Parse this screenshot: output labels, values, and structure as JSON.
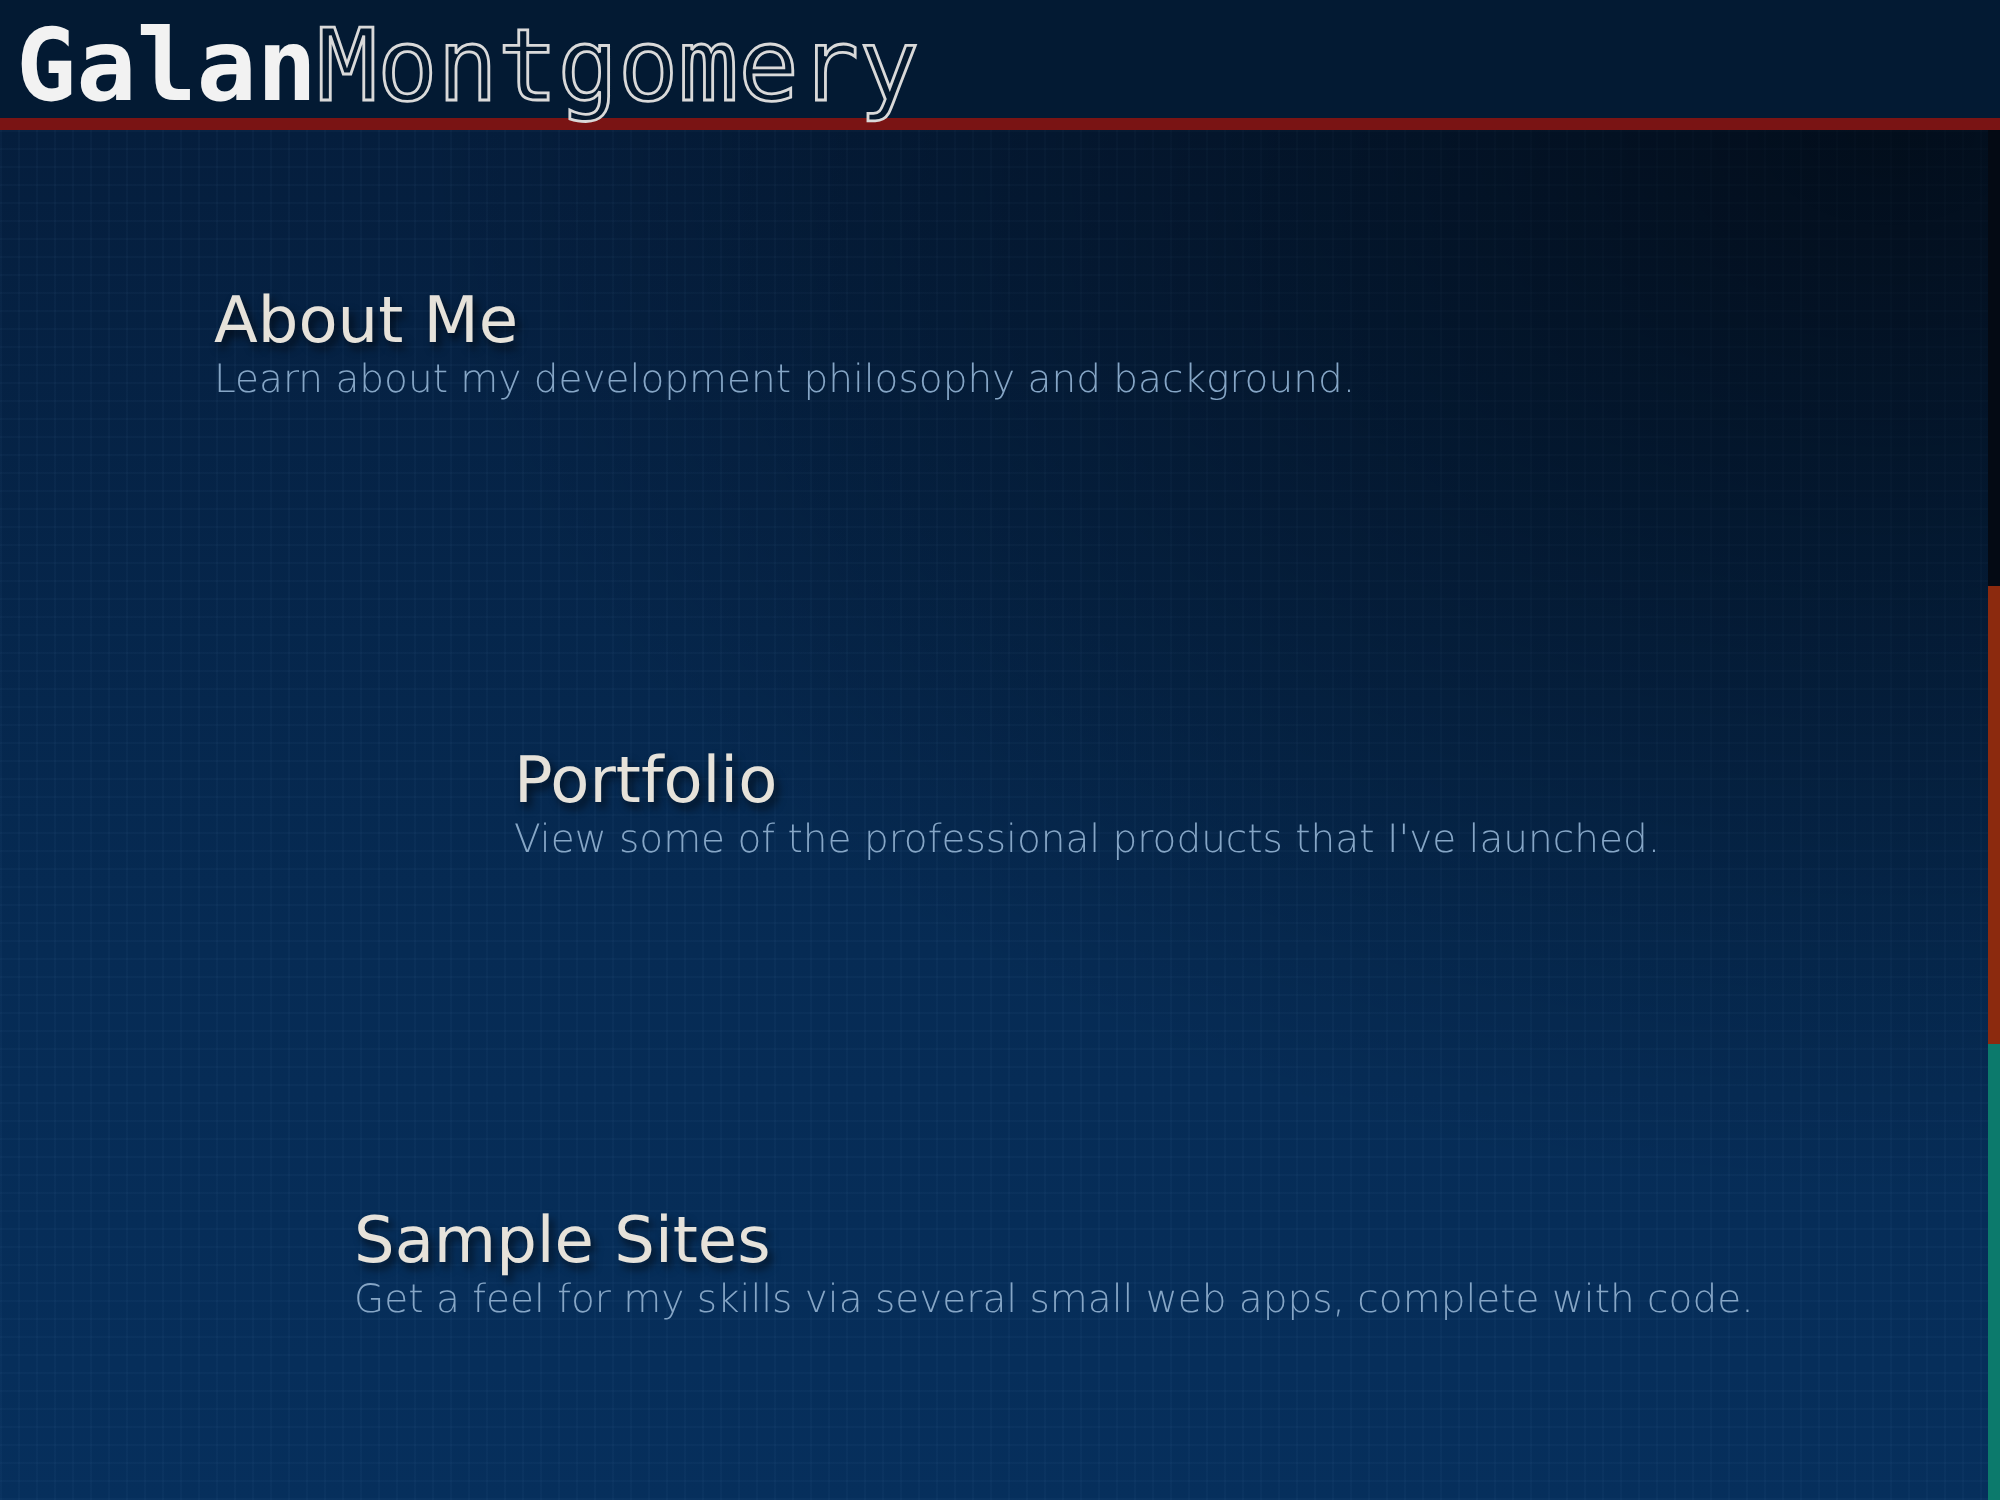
{
  "logo": {
    "first": "Galan",
    "last": "Montgomery"
  },
  "sections": [
    {
      "title": "About Me",
      "description": "Learn about my development philosophy and background."
    },
    {
      "title": "Portfolio",
      "description": "View some of the professional products that I've launched."
    },
    {
      "title": "Sample Sites",
      "description": "Get a feel for my skills via several small web apps, complete with code."
    }
  ],
  "edge_markers": [
    {
      "color": "#040a14"
    },
    {
      "color": "#8c2a0e"
    },
    {
      "color": "#0c7a6c"
    }
  ]
}
